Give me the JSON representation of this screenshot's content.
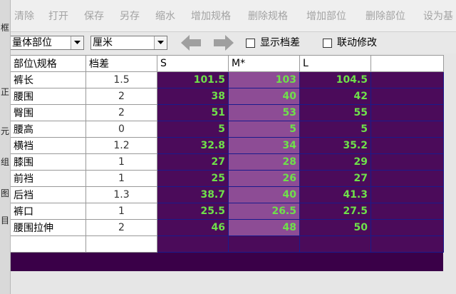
{
  "toolbar": {
    "buttons": [
      {
        "label": "清除"
      },
      {
        "label": "打开"
      },
      {
        "label": "保存"
      },
      {
        "label": "另存"
      },
      {
        "label": "缩水"
      },
      {
        "label": "增加规格"
      },
      {
        "label": "删除规格"
      },
      {
        "label": "增加部位"
      },
      {
        "label": "删除部位"
      },
      {
        "label": "设为基"
      }
    ]
  },
  "left_strip": [
    "框",
    "正",
    "元",
    "组",
    "图",
    "目"
  ],
  "controls": {
    "position_select": "量体部位",
    "unit_select": "厘米",
    "show_diff_label": "显示档差",
    "linked_edit_label": "联动修改"
  },
  "grid": {
    "headers": [
      "部位\\规格",
      "档差",
      "S",
      "M*",
      "L",
      ""
    ],
    "rows": [
      {
        "part": "裤长",
        "diff": "1.5",
        "s": "101.5",
        "m": "103",
        "l": "104.5"
      },
      {
        "part": "腰围",
        "diff": "2",
        "s": "38",
        "m": "40",
        "l": "42"
      },
      {
        "part": "臀围",
        "diff": "2",
        "s": "51",
        "m": "53",
        "l": "55"
      },
      {
        "part": "腰高",
        "diff": "0",
        "s": "5",
        "m": "5",
        "l": "5"
      },
      {
        "part": "横裆",
        "diff": "1.2",
        "s": "32.8",
        "m": "34",
        "l": "35.2"
      },
      {
        "part": "膝围",
        "diff": "1",
        "s": "27",
        "m": "28",
        "l": "29"
      },
      {
        "part": "前裆",
        "diff": "1",
        "s": "25",
        "m": "26",
        "l": "27"
      },
      {
        "part": "后裆",
        "diff": "1.3",
        "s": "38.7",
        "m": "40",
        "l": "41.3"
      },
      {
        "part": "裤口",
        "diff": "1",
        "s": "25.5",
        "m": "26.5",
        "l": "27.5"
      },
      {
        "part": "腰围拉伸",
        "diff": "2",
        "s": "46",
        "m": "48",
        "l": "50"
      }
    ]
  },
  "colors": {
    "cell_dark": "#4b0b5a",
    "cell_selected_col": "#8d4c95",
    "value_text": "#6fe04a"
  }
}
